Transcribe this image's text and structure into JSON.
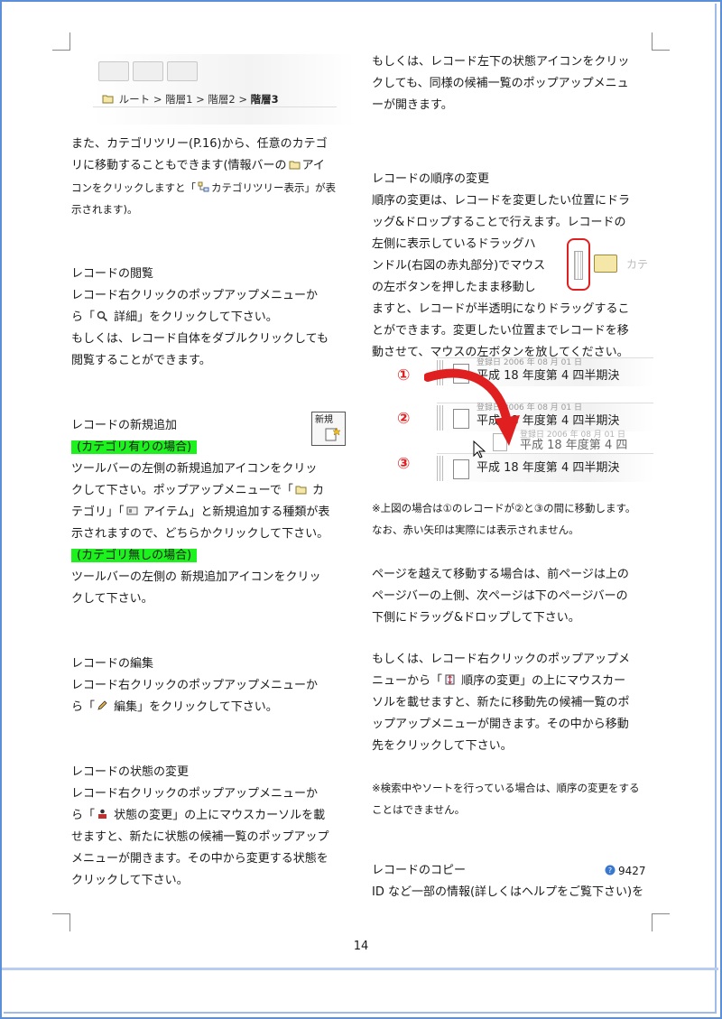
{
  "left": {
    "breadcrumb": {
      "root": "ルート",
      "sep": ">",
      "l1": "階層1",
      "l2": "階層2",
      "l3": "階層3"
    },
    "intro": [
      "また、カテゴリツリー(P.16)から、任意のカテゴ",
      "リに移動することもできます(情報バーの",
      "アイ",
      "コンをクリックしますと「",
      "カテゴリツリー表示」が表",
      "示されます)。"
    ],
    "view": {
      "heading": "レコードの閲覧",
      "lines": [
        "レコード右クリックのポップアップメニューか",
        "ら「",
        " 詳細」をクリックして下さい。",
        "もしくは、レコード自体をダブルクリックしても",
        "閲覧することができます。"
      ]
    },
    "add": {
      "heading": "レコードの新規追加",
      "icon_label": "新規",
      "badge1": "(カテゴリ有りの場合)",
      "lines1": [
        "ツールバーの左側の新規追加アイコンをクリッ",
        "クして下さい。ポップアップメニューで「",
        " カ",
        "テゴリ」「",
        " アイテム」と新規追加する種類が表",
        "示されますので、どちらかクリックして下さい。"
      ],
      "badge2": "(カテゴリ無しの場合)",
      "lines2": [
        "ツールバーの左側の 新規追加アイコンをクリッ",
        "クして下さい。"
      ]
    },
    "edit": {
      "heading": "レコードの編集",
      "lines": [
        "レコード右クリックのポップアップメニューか",
        "ら「",
        " 編集」をクリックして下さい。"
      ]
    },
    "status": {
      "heading": "レコードの状態の変更",
      "lines": [
        "レコード右クリックのポップアップメニューか",
        "ら「",
        " 状態の変更」の上にマウスカーソルを載",
        "せますと、新たに状態の候補一覧のポップアップ",
        "メニューが開きます。その中から変更する状態を",
        "クリックして下さい。"
      ]
    }
  },
  "right": {
    "top": [
      "もしくは、レコード左下の状態アイコンをクリッ",
      "クしても、同様の候補一覧のポップアップメニュ",
      "ーが開きます。"
    ],
    "order": {
      "heading": "レコードの順序の変更",
      "lines": [
        "順序の変更は、レコードを変更したい位置にドラ",
        "ッグ&ドロップすることで行えます。レコードの",
        "左側に表示しているドラッグハ",
        "ンドル(右図の赤丸部分)でマウス",
        "の左ボタンを押したまま移動し",
        "ますと、レコードが半透明になりドラッグするこ",
        "とができます。変更したい位置までレコードを移",
        "動させて、マウスの左ボタンを放してください。"
      ],
      "drag_fade": "カテ",
      "records": {
        "n1": "①",
        "n2": "②",
        "n3": "③",
        "date": "登録日 2006 年 08 月 01 日",
        "title": "平成 18 年度第 4 四半期決",
        "ghost_date": "登録日 2006 年 08 月 01 日",
        "ghost_title": "平成 18 年度第 4 四"
      },
      "note": [
        "※上図の場合は①のレコードが②と③の間に移動します。",
        "なお、赤い矢印は実際には表示されません。"
      ],
      "page_move": [
        "ページを越えて移動する場合は、前ページは上の",
        "ページバーの上側、次ページは下のページバーの",
        "下側にドラッグ&ドロップして下さい。"
      ],
      "popup": [
        "もしくは、レコード右クリックのポップアップメ",
        "ニューから「",
        " 順序の変更」の上にマウスカー",
        "ソルを載せますと、新たに移動先の候補一覧のポ",
        "ップアップメニューが開きます。その中から移動",
        "先をクリックして下さい。"
      ],
      "search_note": [
        "※検索中やソートを行っている場合は、順序の変更をする",
        "ことはできません。"
      ]
    },
    "copy": {
      "heading": "レコードのコピー",
      "help_id": "9427",
      "line": "ID など一部の情報(詳しくはヘルプをご覧下さい)を"
    }
  },
  "page_number": "14",
  "colors": {
    "frame": "#5b8fd6",
    "highlight": "#1ef21e",
    "accent_red": "#e02020"
  }
}
